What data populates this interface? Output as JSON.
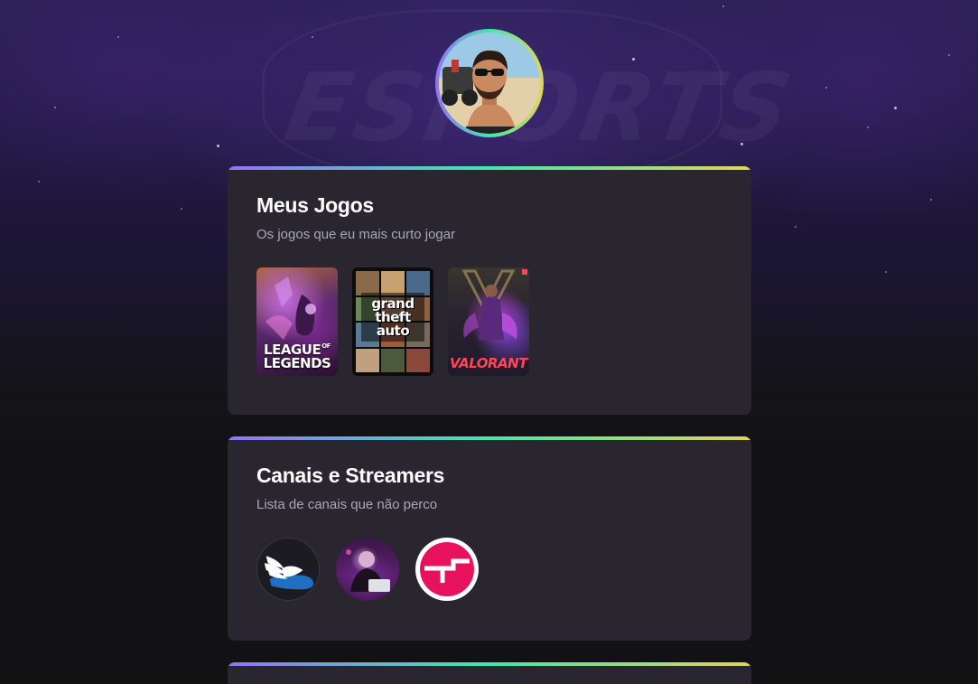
{
  "profile": {
    "avatar_alt": "Foto de perfil"
  },
  "sections": [
    {
      "title": "Meus Jogos",
      "subtitle": "Os jogos que eu mais curto jogar",
      "games": [
        {
          "name": "LEAGUE OF LEGENDS",
          "line1": "LEAGUE",
          "line2": "LEGENDS"
        },
        {
          "name": "Grand Theft Auto",
          "line1": "grand",
          "line2": "theft",
          "line3": "auto"
        },
        {
          "name": "VALORANT",
          "line1": "VALORANT"
        }
      ]
    },
    {
      "title": "Canais e Streamers",
      "subtitle": "Lista de canais que não perco",
      "channels": [
        {
          "icon": "winged-shoe-icon"
        },
        {
          "icon": "streamer-avatar"
        },
        {
          "icon": "brand-logo-icon"
        }
      ]
    }
  ],
  "colors": {
    "background": "#121214",
    "card": "#29262f",
    "title": "#ffffff",
    "subtitle": "#a8a8b3",
    "gradient": [
      "#9572fc",
      "#43e7ad",
      "#e2d45c"
    ],
    "valorant_red": "#ff4655",
    "brand_pink": "#e8115b"
  }
}
